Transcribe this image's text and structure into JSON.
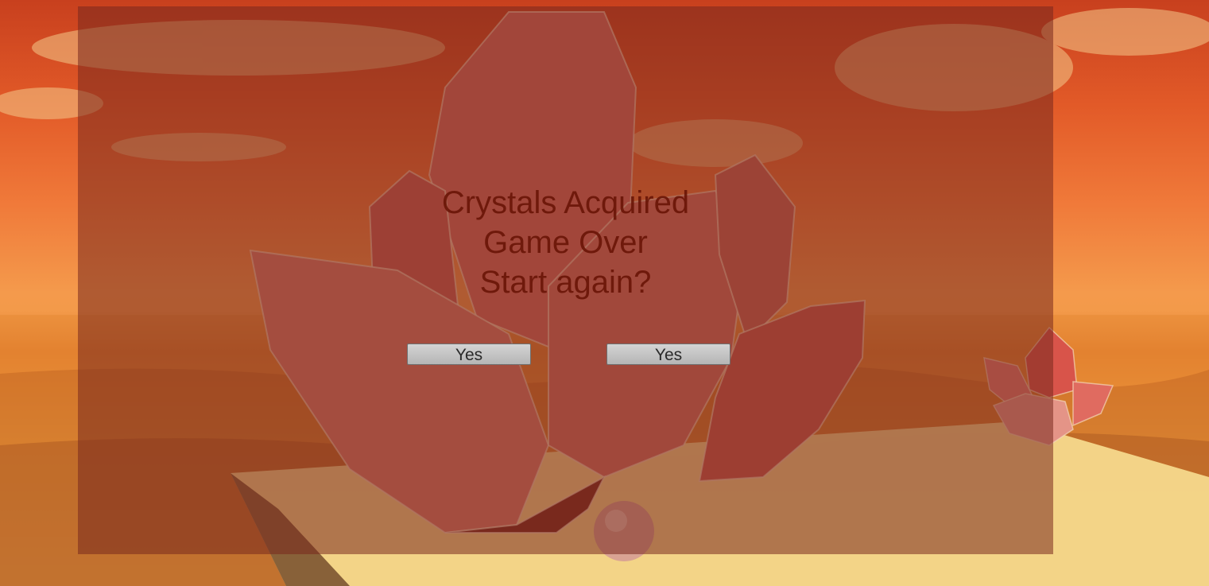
{
  "dialog": {
    "line1": "Crystals Acquired",
    "line2": "Game Over",
    "line3": "Start again?"
  },
  "buttons": {
    "left_label": "Yes",
    "right_label": "Yes"
  },
  "colors": {
    "overlay": "#783c28",
    "text": "#6a1506",
    "button": "#c4c4c4",
    "sky": "#e25a28",
    "sea": "#f0a040",
    "crystal": "#c8635a"
  }
}
